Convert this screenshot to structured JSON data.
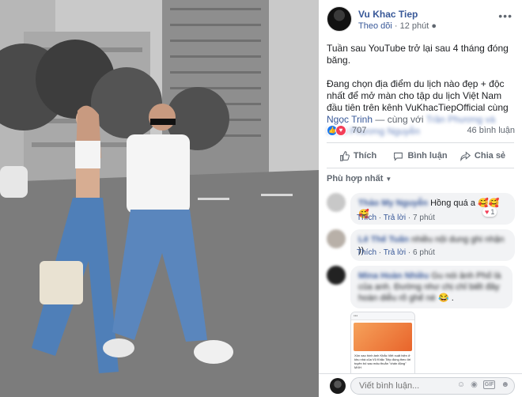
{
  "post": {
    "author": "Vu Khac Tiep",
    "follow_label": "Theo dõi",
    "time": "12 phút",
    "paragraph1": "Tuần sau YouTube trở lại sau 4 tháng đóng băng.",
    "paragraph2_a": "Đang chọn địa điểm du lịch nào đẹp + độc nhất để mở màn cho tập du lịch Việt Nam đầu tiên trên kênh VuKhacTiepOfficial cùng ",
    "tag1": "Ngọc Trinh",
    "paragraph2_b": " — cùng với ",
    "tag2": "Trần Phương",
    "tag_sep": " và ",
    "tag3": "Minh Phương Nguyễn",
    "reaction_count": "707",
    "comment_count": "46 bình luận"
  },
  "actions": {
    "like": "Thích",
    "comment": "Bình luận",
    "share": "Chia sẻ"
  },
  "sort_label": "Phù hợp nhất",
  "comments": [
    {
      "name": "Thảo My Nguyễn",
      "text": "Hồng quá a 🥰🥰🥰",
      "like": "Thích",
      "reply": "Trả lời",
      "time": "7 phút",
      "reactions": "1"
    },
    {
      "name": "Lê Thế Tuấn",
      "text": "nhiều nội dung ghi nhận",
      "emoji": "))",
      "like": "Thích",
      "reply": "Trả lời",
      "time": "6 phút"
    },
    {
      "name": "Mina Hoàn Nhiều",
      "text_blur": "Gu nói ảnh Phố là của anh. Đường như chị chỉ biết đây",
      "text_blur2": "hoàn diễu rõ ghế nè",
      "emoji": "😂 .",
      "link_preview": "Xôn xao hình ảnh Khắc Việt xuất hiện ở khu nhà của Vũ Khắc Tiệp đúng theo lời tuyên bố sau mâu thuẫn \"chấn động\" MXH"
    }
  ],
  "comment_input": {
    "placeholder": "Viết bình luận..."
  },
  "colors": {
    "link": "#385898",
    "like_blue": "#1877f2",
    "love_red": "#f33e58"
  }
}
